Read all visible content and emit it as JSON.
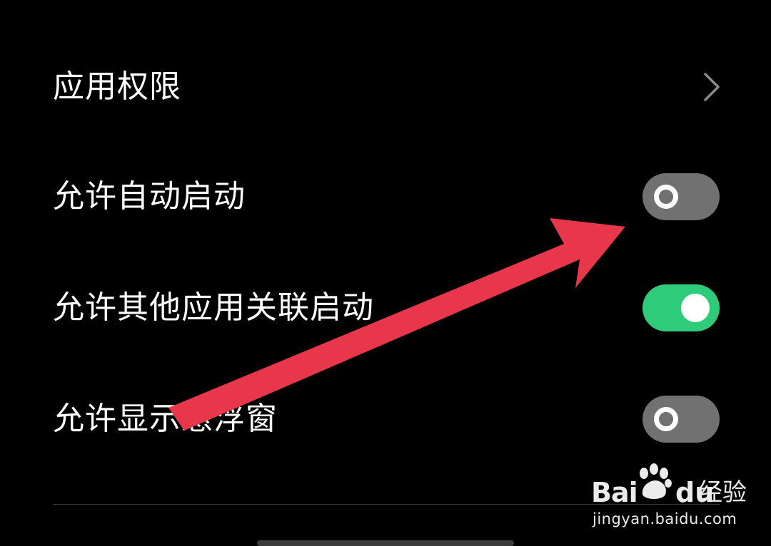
{
  "settings": {
    "items": [
      {
        "label": "应用权限",
        "control": "chevron",
        "icon": "chevron-right-icon"
      },
      {
        "label": "允许自动启动",
        "control": "toggle",
        "state": "off"
      },
      {
        "label": "允许其他应用关联启动",
        "control": "toggle",
        "state": "on"
      },
      {
        "label": "允许显示悬浮窗",
        "control": "toggle",
        "state": "off"
      }
    ]
  },
  "overlay": {
    "arrow_icon": "red-arrow-icon",
    "arrow_color": "#e8364a"
  },
  "watermark": {
    "brand_left": "Bai",
    "brand_right": "du",
    "product": "经验",
    "url": "jingyan.baidu.com",
    "icon": "paw-icon"
  },
  "colors": {
    "background": "#000000",
    "toggle_on": "#2ecc7a",
    "toggle_off": "#717171",
    "text": "#ffffff",
    "chevron": "#8a8a8a"
  }
}
